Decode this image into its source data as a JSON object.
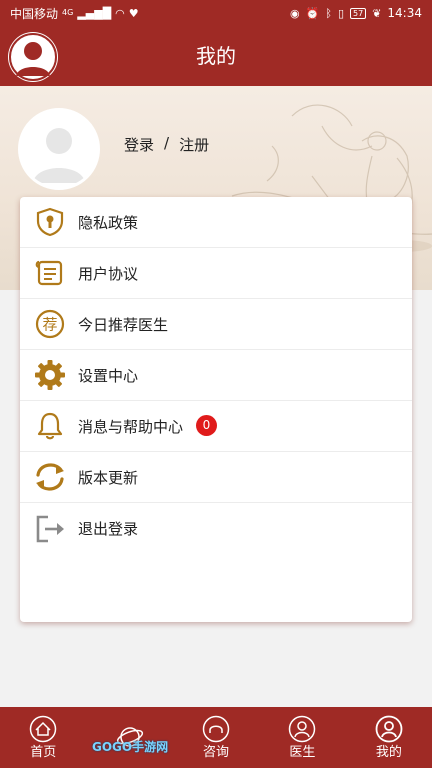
{
  "status_bar": {
    "carrier": "中国移动",
    "network": "4G",
    "battery": "57",
    "time": "14:34"
  },
  "header": {
    "title": "我的"
  },
  "profile": {
    "login_label": "登录",
    "separator": "/",
    "register_label": "注册"
  },
  "menu": {
    "items": [
      {
        "label": "隐私政策",
        "icon": "shield-lock-icon"
      },
      {
        "label": "用户协议",
        "icon": "scroll-document-icon"
      },
      {
        "label": "今日推荐医生",
        "icon": "recommend-seal-icon"
      },
      {
        "label": "设置中心",
        "icon": "gear-icon"
      },
      {
        "label": "消息与帮助中心",
        "icon": "bell-icon",
        "badge": "0"
      },
      {
        "label": "版本更新",
        "icon": "refresh-icon"
      },
      {
        "label": "退出登录",
        "icon": "logout-icon"
      }
    ]
  },
  "bottom_nav": {
    "items": [
      {
        "label": "首页",
        "icon": "home-icon"
      },
      {
        "label": "",
        "icon": "planet-icon"
      },
      {
        "label": "咨询",
        "icon": "consult-icon"
      },
      {
        "label": "医生",
        "icon": "doctor-icon"
      },
      {
        "label": "我的",
        "icon": "profile-icon"
      }
    ]
  },
  "watermark": "GOGO手游网",
  "colors": {
    "brand": "#9f2a25",
    "icon_gold": "#b07a1a",
    "badge": "#e01b1b"
  }
}
